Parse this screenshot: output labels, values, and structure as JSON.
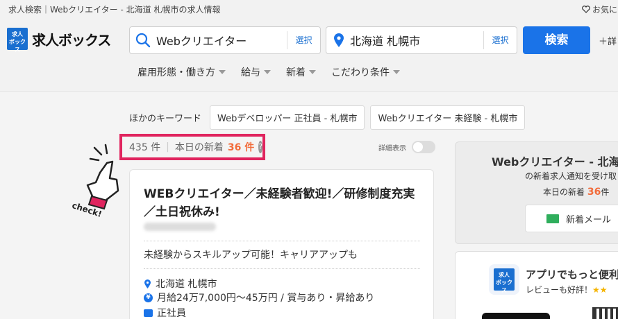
{
  "topbar": {
    "breadcrumb": "求人検索｜Webクリエイター - 北海道 札幌市の求人情報",
    "favorite_label": "お気に"
  },
  "header": {
    "logo_box_text": "求人\nボックス",
    "logo_text": "求人ボックス",
    "keyword_value": "Webクリエイター",
    "keyword_select": "選択",
    "location_value": "北海道 札幌市",
    "location_select": "選択",
    "search_button": "検索",
    "register_label": "＋詳"
  },
  "filters": [
    {
      "label": "雇用形態・働き方"
    },
    {
      "label": "給与"
    },
    {
      "label": "新着"
    },
    {
      "label": "こだわり条件"
    }
  ],
  "other_keywords": {
    "label": "ほかのキーワード",
    "chips": [
      "Webデベロッパー 正社員 - 札幌市",
      "Webクリエイター 未経験 - 札幌市"
    ]
  },
  "results": {
    "count": "435 件",
    "today_label": "本日の新着",
    "today_count": "36 件",
    "info_icon": "?",
    "detail_toggle_label": "詳細表示"
  },
  "decoration": {
    "check_text": "check!"
  },
  "job_card": {
    "title": "WEBクリエイター／未経験者歓迎!／研修制度充実／土日祝休み!",
    "catch": "未経験からスキルアップ可能！キャリアアップも",
    "location": "北海道 札幌市",
    "salary": "月給24万7,000円〜45万円 / 賞与あり・昇給あり",
    "employment": "正社員"
  },
  "side_panel": {
    "title": "Webクリエイター - 北海",
    "subtitle": "の新着求人通知を受け取",
    "today_label": "本日の新着",
    "today_count": "36",
    "today_suffix": "件",
    "mail_button": "新着メール"
  },
  "app_panel": {
    "icon_text": "求人\nボックス",
    "title": "アプリでもっと便利",
    "review": "レビューも好評！",
    "stars": "★★"
  },
  "colors": {
    "brand_blue": "#1a73e8",
    "accent_orange": "#f26b3a",
    "highlight_pink": "#e0245e",
    "mail_green": "#2fae5c"
  }
}
